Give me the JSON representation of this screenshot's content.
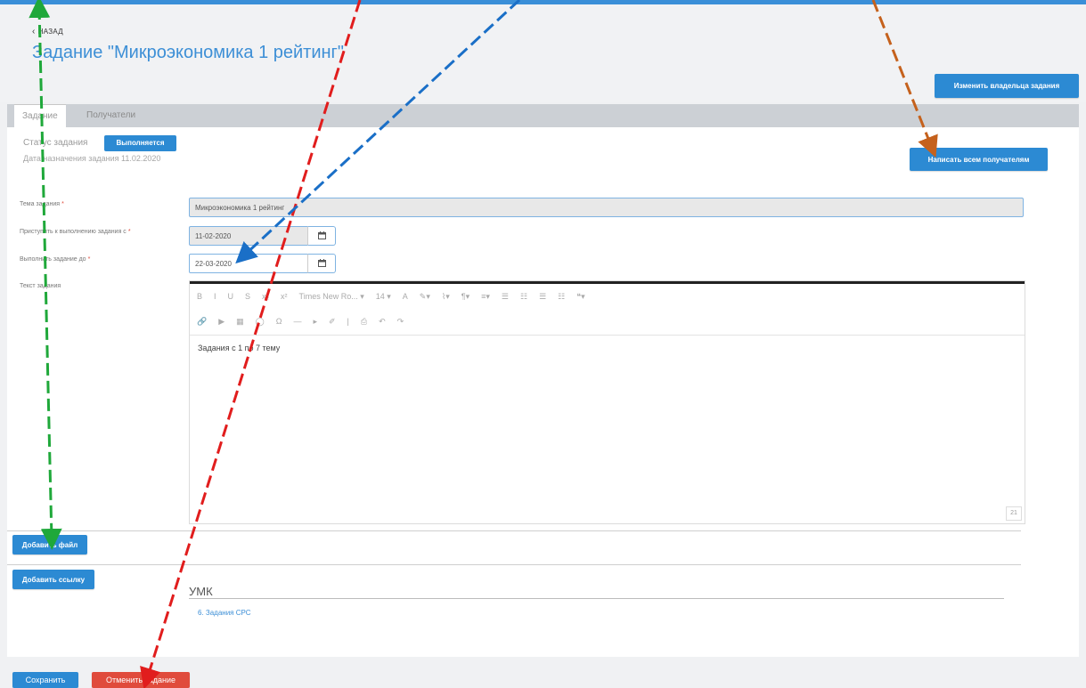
{
  "header": {
    "back_label": "НАЗАД",
    "title": "Задание \"Микроэкономика 1 рейтинг\"",
    "change_owner_label": "Изменить владельца задания"
  },
  "tabs": [
    {
      "label": "Задание",
      "active": true
    },
    {
      "label": "Получатели",
      "active": false
    }
  ],
  "status": {
    "label": "Статус задания",
    "badge": "Выполняется",
    "badge_color": "#2c8ad3",
    "assign_date": "Дата назначения задания 11.02.2020"
  },
  "write_all_label": "Написать всем получателям",
  "form": {
    "topic_label": "Тема задания",
    "topic_value": "Микроэкономика 1 рейтинг",
    "start_label": "Приступить к выполнению задания с",
    "start_value": "11-02-2020",
    "due_label": "Выполнить задание до",
    "due_value": "22-03-2020",
    "text_label": "Текст задания"
  },
  "editor": {
    "toolbar_row1": [
      "B",
      "I",
      "U",
      "S",
      "x₂",
      "x²",
      "Times New Ro... ▾",
      "14 ▾",
      "A",
      "✎▾",
      "⌇▾",
      "¶▾",
      "≡▾",
      "☰",
      "☷",
      "☰",
      "☷",
      "❝▾"
    ],
    "toolbar_row2": [
      "🔗",
      "▶",
      "▦",
      "◯",
      "Ω",
      "—",
      "▸",
      "✐",
      "|",
      "⎙",
      "↶",
      "↷"
    ],
    "content": "Задания с 1 по 7 тему",
    "word_count": "21"
  },
  "buttons": {
    "add_file": "Добавить файл",
    "add_link": "Добавить ссылку",
    "save": "Сохранить",
    "cancel_task": "Отменить задание"
  },
  "umk": {
    "title": "УМК",
    "link": "6. Задания СРС"
  },
  "colors": {
    "accent": "#2c8ad3",
    "danger": "#e04b3c"
  }
}
